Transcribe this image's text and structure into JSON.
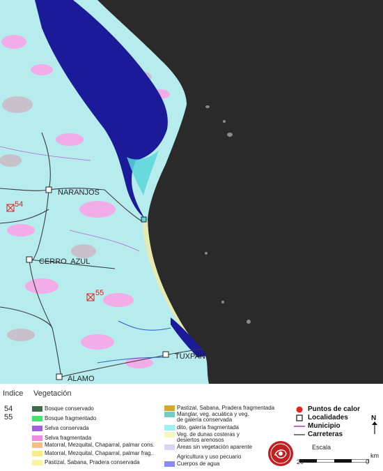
{
  "map": {
    "colors": {
      "sea": "#2a2a2a",
      "land": "#b7ecef",
      "water": "#1b1b9a",
      "lagoon": "#5ad6d9",
      "beach": "#ebe9a8",
      "pink": "#f2ade8",
      "greyveg": "#c8c0ca",
      "road": "#3a3a3a",
      "river": "#3060c8"
    },
    "towns": [
      {
        "name": "NARANJOS"
      },
      {
        "name": "CERRO  AZUL"
      },
      {
        "name": "TUXPAN"
      },
      {
        "name": "ALAMO"
      }
    ],
    "hotspot_indices": [
      "54",
      "55"
    ]
  },
  "legend": {
    "indice_header": "Indice",
    "vegetacion_header": "Vegetación",
    "indices": [
      "54",
      "55"
    ],
    "col1": [
      {
        "label": "Bosque conservado",
        "color": "#3f6d4c"
      },
      {
        "label": "Bosque fragmentado",
        "color": "#49e06b"
      },
      {
        "label": "Selva conservada",
        "color": "#a060e0"
      },
      {
        "label": "Selva fragmentada",
        "color": "#f08ce0"
      },
      {
        "label": "Matorral, Mezquital, Chaparral, palmar cons.",
        "color": "#f0c088"
      },
      {
        "label": "Matorral, Mezquital, Chaparral, palmar frag..",
        "color": "#f5ee88"
      },
      {
        "label": "Pastizal, Sabana, Pradera conservada",
        "color": "#f8f4a0"
      }
    ],
    "col2": [
      {
        "label": "Pastizal, Sabana, Pradera fragmentada",
        "color": "#d4a830"
      },
      {
        "label": "Manglar, veg. acuática y veg.\nde galería conservada",
        "color": "#74ccc4"
      },
      {
        "label": "dito, galería fragmentada",
        "color": "#9ef0f0"
      },
      {
        "label": "Veg. de dunas costeras y\ndesiertos arenosos",
        "color": "#f8f6c0"
      },
      {
        "label": "Áreas sin vegetación aparente",
        "color": "#d6d6ee"
      },
      {
        "label": "Agricultura y uso pecuario",
        "color": "#ffffff"
      },
      {
        "label": "Cuerpos de agua",
        "color": "#8a8af0"
      }
    ],
    "symbols": {
      "puntos": "Puntos de calor",
      "localidades": "Localidades",
      "municipio": "Municipio",
      "carreteras": "Carreteras"
    },
    "scale": {
      "title": "Escala",
      "left": "20",
      "right": "0",
      "unit": "km"
    },
    "north": "N"
  }
}
